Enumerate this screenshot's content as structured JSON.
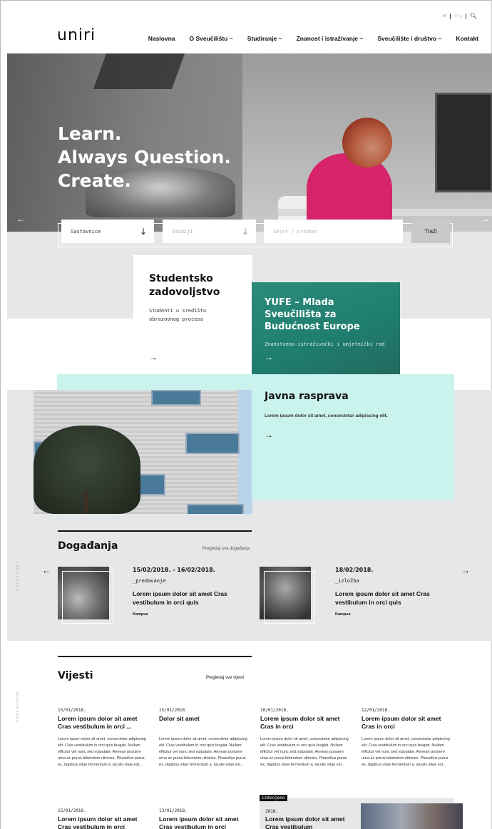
{
  "header": {
    "lang": {
      "hr": "hr",
      "en": "Eng"
    },
    "logo": "uniri",
    "nav": [
      "Naslovna",
      "O Sveučilištu ~",
      "Studiranje ~",
      "Znanost i istraživanje ~",
      "Sveučilište i društvo ~",
      "Kontakt"
    ]
  },
  "hero": {
    "line1": "Learn.",
    "line2": "Always Question.",
    "line3": "Create."
  },
  "search": {
    "select1": "Sastavnice",
    "select2": "Studiji",
    "input_placeholder": "Smjer / predmet",
    "button": "Traži"
  },
  "cards": {
    "student": {
      "title": "Studentsko zadovoljstvo",
      "subtitle": "Studenti u središtu obrazovnog procesa"
    },
    "yufe": {
      "title": "YUFE – Mlada Sveučilišta za Budućnost Europe",
      "subtitle": "Znanstveno-istraživački i umjetnički rad"
    },
    "javna": {
      "title": "Javna rasprava",
      "desc": "Lorem ipsum dolor sit amet, consectetur adipiscing elit."
    }
  },
  "events": {
    "title": "Događanja",
    "link": "Pregledaj sva događanja",
    "side_label": "PREGLEDAJ",
    "items": [
      {
        "date": "15/02/2018. - 16/02/2018.",
        "type": "_predavanje",
        "title": "Lorem ipsum dolor sit amet Cras vestibulum in orci quis",
        "location": "Kampus"
      },
      {
        "date": "18/02/2018.",
        "type": "_izložba",
        "title": "Lorem ipsum dolor sit amet Cras vestibulum in orci quis",
        "location": "Kampus"
      }
    ]
  },
  "news": {
    "title": "Vijesti",
    "link": "Pregledaj sve vijesti",
    "side_label": "KATEGORIJE",
    "items": [
      {
        "date": "15/01/2018.",
        "title": "Lorem ipsum dolor sit amet Cras vestibulum in orci ...",
        "body": "Lorem ipsum dolor sit amet, consectetur adipiscing elit. Cras vestibulum in orci quis feugiat. Nullam efficitur vel nunc sed vulputate. Aenean posuere urna ac purus bibendum ultricies. Phasellus purus ex, dapibus vitae fermentum a, iaculis vitae est..."
      },
      {
        "date": "15/01/2018.",
        "title": "Dolor sit amet",
        "body": "Lorem ipsum dolor sit amet, consectetur adipiscing elit. Cras vestibulum in orci quis feugiat. Nullam efficitur vel nunc sed vulputate. Aenean posuere urna ac purus bibendum ultricies. Phasellus purus ex, dapibus vitae fermentum a, iaculis vitae est..."
      },
      {
        "date": "10/01/2018.",
        "title": "Lorem ipsum dolor sit amet Cras in orci",
        "body": "Lorem ipsum dolor sit amet, consectetur adipiscing elit. Cras vestibulum in orci quis feugiat. Nullam efficitur vel nunc sed vulputate. Aenean posuere urna ac purus bibendum ultricies. Phasellus purus ex, dapibus vitae fermentum a, iaculis vitae est..."
      },
      {
        "date": "12/01/2018.",
        "title": "Lorem ipsum dolor sit amet Cras in orci",
        "body": "Lorem ipsum dolor sit amet, consectetur adipiscing elit. Cras vestibulum in orci quis feugiat. Nullam efficitur vel nunc sed vulputate. Aenean posuere urna ac purus bibendum ultricies. Phasellus purus ex, dapibus vitae fermentum a, iaculis vitae est..."
      },
      {
        "date": "15/01/2018.",
        "title": "Lorem ipsum dolor sit amet Cras vestibulum in orci"
      },
      {
        "date": "13/01/2018.",
        "title": "Lorem ipsum dolor sit amet Cras vestibulum in orci"
      }
    ],
    "featured": {
      "tag": "izdvojeno",
      "date": "2018.",
      "title": "Lorem ipsum dolor sit amet Cras vestibulum"
    }
  },
  "colors": {
    "teal": "#1f7d6e",
    "mint": "#cbf3ee",
    "grey_band": "#e6e7e8"
  }
}
